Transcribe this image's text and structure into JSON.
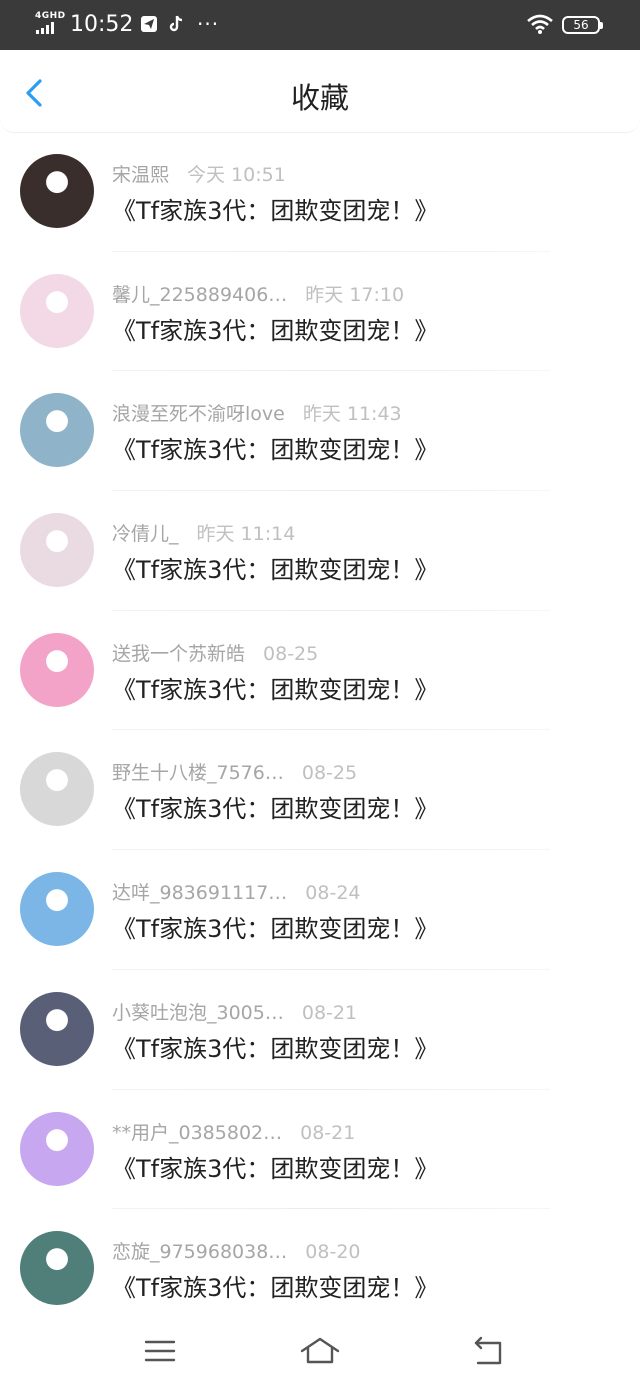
{
  "status_bar": {
    "network": "4GHD",
    "time": "10:52",
    "app_icons": [
      "telegram-icon",
      "tiktok-icon"
    ],
    "more": "···",
    "battery": "56"
  },
  "header": {
    "back_icon": "chevron-left-icon",
    "title": "收藏"
  },
  "items": [
    {
      "user": "宋温熙",
      "time": "今天 10:51",
      "title": "《Tf家族3代：团欺变团宠！》",
      "avatar_color": "#3a2e2c"
    },
    {
      "user": "馨儿_225889406…",
      "time": "昨天 17:10",
      "title": "《Tf家族3代：团欺变团宠！》",
      "avatar_color": "#f3d9e6"
    },
    {
      "user": "浪漫至死不渝呀love",
      "time": "昨天 11:43",
      "title": "《Tf家族3代：团欺变团宠！》",
      "avatar_color": "#8fb3c9"
    },
    {
      "user": "冷倩儿_",
      "time": "昨天 11:14",
      "title": "《Tf家族3代：团欺变团宠！》",
      "avatar_color": "#e9dbe1"
    },
    {
      "user": "送我一个苏新皓",
      "time": "08-25",
      "title": "《Tf家族3代：团欺变团宠！》",
      "avatar_color": "#f3a3c8"
    },
    {
      "user": "野生十八楼_7576…",
      "time": "08-25",
      "title": "《Tf家族3代：团欺变团宠！》",
      "avatar_color": "#d8d8d8"
    },
    {
      "user": "达咩_983691117…",
      "time": "08-24",
      "title": "《Tf家族3代：团欺变团宠！》",
      "avatar_color": "#7bb6e6"
    },
    {
      "user": "小葵吐泡泡_3005…",
      "time": "08-21",
      "title": "《Tf家族3代：团欺变团宠！》",
      "avatar_color": "#5a5f78"
    },
    {
      "user": "**用户_0385802…",
      "time": "08-21",
      "title": "《Tf家族3代：团欺变团宠！》",
      "avatar_color": "#c7a7ef"
    },
    {
      "user": "恋旋_975968038…",
      "time": "08-20",
      "title": "《Tf家族3代：团欺变团宠！》",
      "avatar_color": "#4f7f78"
    }
  ],
  "bottom_nav": {
    "menu_icon": "menu-icon",
    "home_icon": "home-icon",
    "back_icon": "return-icon"
  }
}
